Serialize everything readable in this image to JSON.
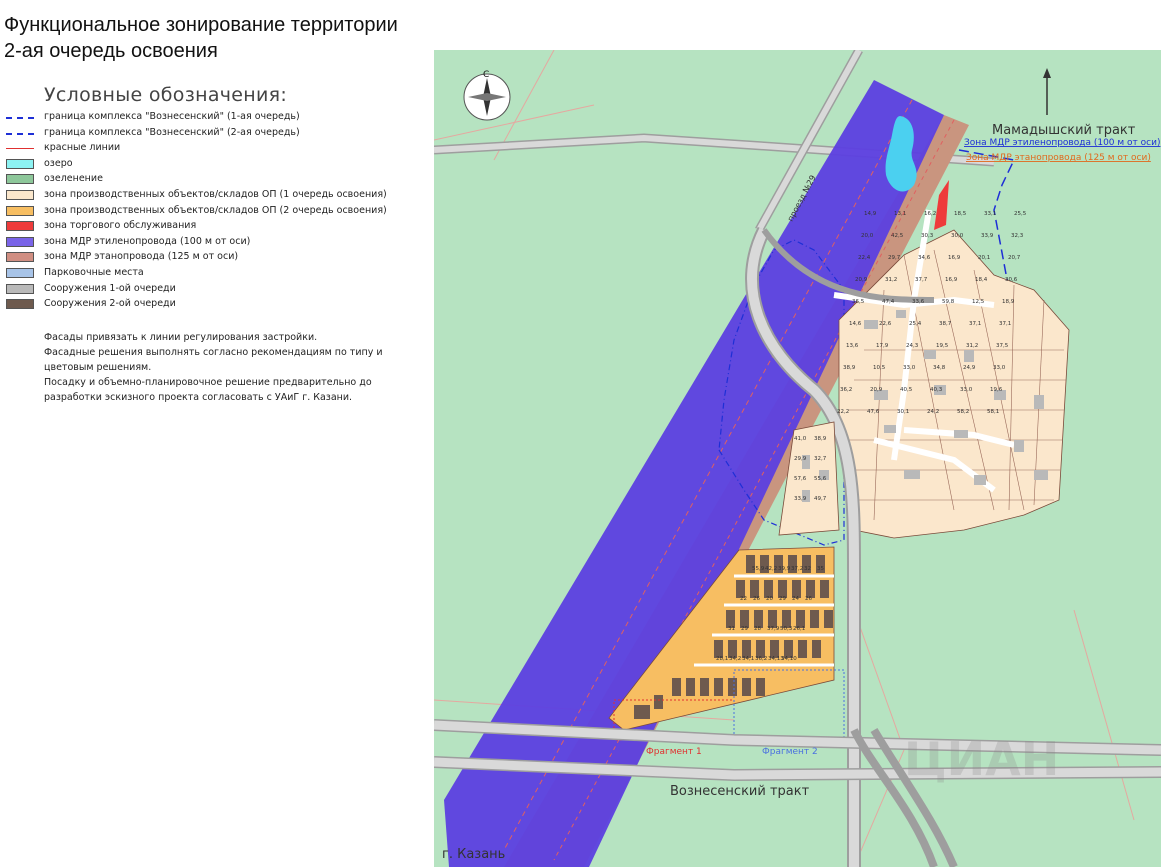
{
  "title": {
    "line1": "Функциональное зонирование территории",
    "line2": "2-ая очередь освоения"
  },
  "legend": {
    "title": "Условные обозначения:",
    "items": [
      {
        "kind": "dashdot",
        "color": "#1e2fd6",
        "label": "граница комплекса \"Вознесенский\" (1-ая очередь)"
      },
      {
        "kind": "dashdot",
        "color": "#1e2fd6",
        "label": "граница комплекса \"Вознесенский\" (2-ая очередь)"
      },
      {
        "kind": "line",
        "color": "#e03030",
        "label": "красные линии"
      },
      {
        "kind": "box",
        "color": "#8df3f3",
        "label": "озеро"
      },
      {
        "kind": "box",
        "color": "#8dc79a",
        "label": "озеленение"
      },
      {
        "kind": "box",
        "color": "#fbe7cc",
        "label": "зона производственных объектов/складов ОП (1 очередь освоения)"
      },
      {
        "kind": "box",
        "color": "#f7be62",
        "label": "зона производственных объектов/складов ОП (2 очередь освоения)"
      },
      {
        "kind": "box",
        "color": "#ee3b3b",
        "label": "зона торгового обслуживания"
      },
      {
        "kind": "box",
        "color": "#7a64e8",
        "label": "зона МДР этиленопровода (100 м от оси)"
      },
      {
        "kind": "box",
        "color": "#d08e82",
        "label": "зона МДР этанопровода (125 м от оси)"
      },
      {
        "kind": "box",
        "color": "#a8c4e8",
        "label": "Парковочные места"
      },
      {
        "kind": "box",
        "color": "#b9b9b9",
        "label": "Сооружения 1-ой очереди"
      },
      {
        "kind": "box",
        "color": "#6e5a4e",
        "label": "Сооружения 2-ой очереди"
      }
    ]
  },
  "notes": [
    "Фасады привязать к линии регулирования  застройки.",
    "Фасадные решения выполнять согласно рекомендациям по типу и",
    "цветовым решениям.",
    "Посадку и объемно-планировочное решение предварительно до",
    "разработки эскизного проекта согласовать с УАиГ г. Казани."
  ],
  "map": {
    "compass_letter": "С",
    "road_top_right": "Мамадышский тракт",
    "zone_label_ethylene": "Зона МДР этиленопровода (100 м от оси)",
    "zone_label_ethane": "Зона МДР этанопровода (125 м от оси)",
    "road_bottom": "Вознесенский тракт",
    "city_label": "г. Казань",
    "passage_label": "проезд №29",
    "fragment1": "Фрагмент 1",
    "fragment2": "Фрагмент 2",
    "watermark": "ЦИАН",
    "colors": {
      "grass": "#b6e3c1",
      "ethylene": "#5c3fe0",
      "ethane": "#c9957f",
      "phase1": "#fbe7cc",
      "phase2": "#f7be62",
      "retail": "#ee3b3b",
      "lake": "#4bd0f0",
      "road": "#c9c9c9",
      "building2": "#6e5a4e",
      "boundary": "#1e2fd6"
    },
    "plot_numbers": [
      "14,9",
      "13,1",
      "16,2",
      "18,5",
      "33,1",
      "25,5",
      "20,0",
      "42,5",
      "30,3",
      "30,0",
      "33,9",
      "32,3",
      "22,4",
      "29,7",
      "34,6",
      "16,9",
      "20,1",
      "20,7",
      "20,9",
      "31,2",
      "37,7",
      "16,9",
      "18,4",
      "30,6",
      "36,5",
      "47,4",
      "33,6",
      "59,8",
      "12,5",
      "18,9",
      "14,6",
      "22,6",
      "25,4",
      "38,7",
      "37,1",
      "37,1",
      "13,6",
      "17,9",
      "24,3",
      "19,5",
      "31,2",
      "37,5",
      "38,9",
      "10,5",
      "33,0",
      "34,8",
      "24,9",
      "33,0",
      "36,2",
      "20,9",
      "40,5",
      "40,3",
      "33,0",
      "19,6",
      "22,2",
      "47,6",
      "30,1",
      "24,2",
      "58,2",
      "58,1",
      "41,0",
      "38,9",
      "29,9",
      "32,7",
      "57,6",
      "55,6",
      "33,9",
      "49,7",
      "55,9",
      "42,2",
      "39,9",
      "37,2",
      "32",
      "35",
      "22",
      "26",
      "20",
      "29",
      "24",
      "26",
      "31",
      "29",
      "28",
      "37,9",
      "50,3",
      "26,1",
      "28,1",
      "34,2",
      "34,1",
      "36,2",
      "34,13",
      "34,10"
    ]
  }
}
